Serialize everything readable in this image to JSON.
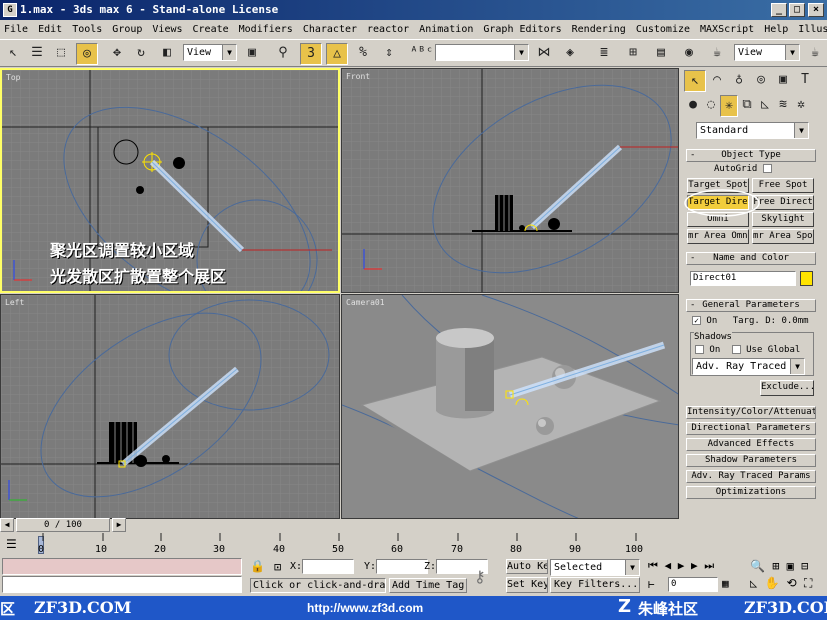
{
  "window": {
    "title": "1.max - 3ds max 6 - Stand-alone License",
    "app_icon": "3ds-max-icon",
    "buttons": [
      "_",
      "□",
      "×"
    ]
  },
  "menubar": [
    "File",
    "Edit",
    "Tools",
    "Group",
    "Views",
    "Create",
    "Modifiers",
    "Character",
    "reactor",
    "Animation",
    "Graph Editors",
    "Rendering",
    "Customize",
    "MAXScript",
    "Help",
    "Illustrate!"
  ],
  "toolbar": {
    "view_dropdown": "View",
    "named_selection": "",
    "view_dropdown2": "View"
  },
  "viewports": {
    "top": {
      "label": "Top"
    },
    "front": {
      "label": "Front"
    },
    "left": {
      "label": "Left"
    },
    "camera": {
      "label": "Camera01"
    }
  },
  "overlay_text": {
    "line1": "聚光区调置较小区域",
    "line2": "光发散区扩散置整个展区"
  },
  "command_panel": {
    "category_dropdown": "Standard",
    "object_type": {
      "header": "Object Type",
      "autogrid_label": "AutoGrid",
      "buttons": [
        "Target Spot",
        "Free Spot",
        "Target Direct",
        "Free Direct",
        "Omni",
        "Skylight",
        "mr Area Omni",
        "mr Area Spot"
      ],
      "active_button": "Target Direct"
    },
    "name_color": {
      "header": "Name and Color",
      "name_value": "Direct01",
      "color": "#ffe400"
    },
    "general": {
      "header": "General Parameters",
      "on_label": "On",
      "targ_label": "Targ. D:",
      "targ_value": "0.0mm",
      "shadows_label": "Shadows",
      "shadows_on_label": "On",
      "use_global_label": "Use Global",
      "shadow_type": "Adv. Ray Traced",
      "exclude_button": "Exclude..."
    },
    "collapsed_rollouts": [
      "Intensity/Color/Attenuation",
      "Directional Parameters",
      "Advanced Effects",
      "Shadow Parameters",
      "Adv. Ray Traced Params",
      "Optimizations"
    ]
  },
  "timeline": {
    "slider_label": "0 / 100",
    "ticks": [
      "0",
      "10",
      "20",
      "30",
      "40",
      "50",
      "60",
      "70",
      "80",
      "90",
      "100"
    ]
  },
  "status": {
    "x_label": "X:",
    "y_label": "Y:",
    "z_label": "Z:",
    "x_value": "",
    "y_value": "",
    "z_value": "",
    "prompt": "Click or click-and-drag",
    "add_time_tag": "Add Time Tag",
    "auto_key": "Auto Key",
    "set_key": "Set Key",
    "selected_dropdown": "Selected",
    "key_filters": "Key Filters...",
    "frame_value": "0"
  },
  "footer": {
    "left_partial": "区",
    "site1": "ZF3D.COM",
    "url": "http://www.zf3d.com",
    "community": "朱峰社区",
    "site2": "ZF3D.COM"
  }
}
